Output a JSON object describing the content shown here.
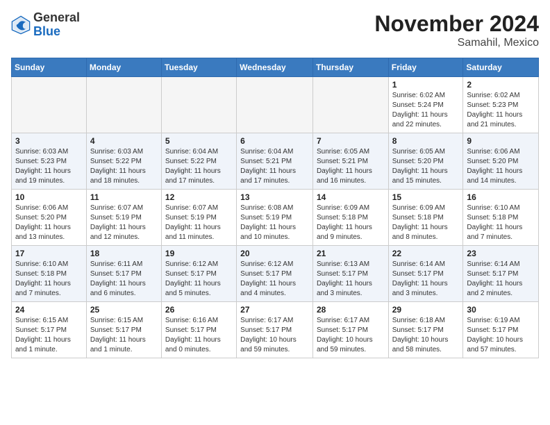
{
  "header": {
    "logo_general": "General",
    "logo_blue": "Blue",
    "month_title": "November 2024",
    "location": "Samahil, Mexico"
  },
  "calendar": {
    "days_of_week": [
      "Sunday",
      "Monday",
      "Tuesday",
      "Wednesday",
      "Thursday",
      "Friday",
      "Saturday"
    ],
    "weeks": [
      [
        {
          "day": "",
          "info": ""
        },
        {
          "day": "",
          "info": ""
        },
        {
          "day": "",
          "info": ""
        },
        {
          "day": "",
          "info": ""
        },
        {
          "day": "",
          "info": ""
        },
        {
          "day": "1",
          "info": "Sunrise: 6:02 AM\nSunset: 5:24 PM\nDaylight: 11 hours and 22 minutes."
        },
        {
          "day": "2",
          "info": "Sunrise: 6:02 AM\nSunset: 5:23 PM\nDaylight: 11 hours and 21 minutes."
        }
      ],
      [
        {
          "day": "3",
          "info": "Sunrise: 6:03 AM\nSunset: 5:23 PM\nDaylight: 11 hours and 19 minutes."
        },
        {
          "day": "4",
          "info": "Sunrise: 6:03 AM\nSunset: 5:22 PM\nDaylight: 11 hours and 18 minutes."
        },
        {
          "day": "5",
          "info": "Sunrise: 6:04 AM\nSunset: 5:22 PM\nDaylight: 11 hours and 17 minutes."
        },
        {
          "day": "6",
          "info": "Sunrise: 6:04 AM\nSunset: 5:21 PM\nDaylight: 11 hours and 17 minutes."
        },
        {
          "day": "7",
          "info": "Sunrise: 6:05 AM\nSunset: 5:21 PM\nDaylight: 11 hours and 16 minutes."
        },
        {
          "day": "8",
          "info": "Sunrise: 6:05 AM\nSunset: 5:20 PM\nDaylight: 11 hours and 15 minutes."
        },
        {
          "day": "9",
          "info": "Sunrise: 6:06 AM\nSunset: 5:20 PM\nDaylight: 11 hours and 14 minutes."
        }
      ],
      [
        {
          "day": "10",
          "info": "Sunrise: 6:06 AM\nSunset: 5:20 PM\nDaylight: 11 hours and 13 minutes."
        },
        {
          "day": "11",
          "info": "Sunrise: 6:07 AM\nSunset: 5:19 PM\nDaylight: 11 hours and 12 minutes."
        },
        {
          "day": "12",
          "info": "Sunrise: 6:07 AM\nSunset: 5:19 PM\nDaylight: 11 hours and 11 minutes."
        },
        {
          "day": "13",
          "info": "Sunrise: 6:08 AM\nSunset: 5:19 PM\nDaylight: 11 hours and 10 minutes."
        },
        {
          "day": "14",
          "info": "Sunrise: 6:09 AM\nSunset: 5:18 PM\nDaylight: 11 hours and 9 minutes."
        },
        {
          "day": "15",
          "info": "Sunrise: 6:09 AM\nSunset: 5:18 PM\nDaylight: 11 hours and 8 minutes."
        },
        {
          "day": "16",
          "info": "Sunrise: 6:10 AM\nSunset: 5:18 PM\nDaylight: 11 hours and 7 minutes."
        }
      ],
      [
        {
          "day": "17",
          "info": "Sunrise: 6:10 AM\nSunset: 5:18 PM\nDaylight: 11 hours and 7 minutes."
        },
        {
          "day": "18",
          "info": "Sunrise: 6:11 AM\nSunset: 5:17 PM\nDaylight: 11 hours and 6 minutes."
        },
        {
          "day": "19",
          "info": "Sunrise: 6:12 AM\nSunset: 5:17 PM\nDaylight: 11 hours and 5 minutes."
        },
        {
          "day": "20",
          "info": "Sunrise: 6:12 AM\nSunset: 5:17 PM\nDaylight: 11 hours and 4 minutes."
        },
        {
          "day": "21",
          "info": "Sunrise: 6:13 AM\nSunset: 5:17 PM\nDaylight: 11 hours and 3 minutes."
        },
        {
          "day": "22",
          "info": "Sunrise: 6:14 AM\nSunset: 5:17 PM\nDaylight: 11 hours and 3 minutes."
        },
        {
          "day": "23",
          "info": "Sunrise: 6:14 AM\nSunset: 5:17 PM\nDaylight: 11 hours and 2 minutes."
        }
      ],
      [
        {
          "day": "24",
          "info": "Sunrise: 6:15 AM\nSunset: 5:17 PM\nDaylight: 11 hours and 1 minute."
        },
        {
          "day": "25",
          "info": "Sunrise: 6:15 AM\nSunset: 5:17 PM\nDaylight: 11 hours and 1 minute."
        },
        {
          "day": "26",
          "info": "Sunrise: 6:16 AM\nSunset: 5:17 PM\nDaylight: 11 hours and 0 minutes."
        },
        {
          "day": "27",
          "info": "Sunrise: 6:17 AM\nSunset: 5:17 PM\nDaylight: 10 hours and 59 minutes."
        },
        {
          "day": "28",
          "info": "Sunrise: 6:17 AM\nSunset: 5:17 PM\nDaylight: 10 hours and 59 minutes."
        },
        {
          "day": "29",
          "info": "Sunrise: 6:18 AM\nSunset: 5:17 PM\nDaylight: 10 hours and 58 minutes."
        },
        {
          "day": "30",
          "info": "Sunrise: 6:19 AM\nSunset: 5:17 PM\nDaylight: 10 hours and 57 minutes."
        }
      ]
    ]
  }
}
